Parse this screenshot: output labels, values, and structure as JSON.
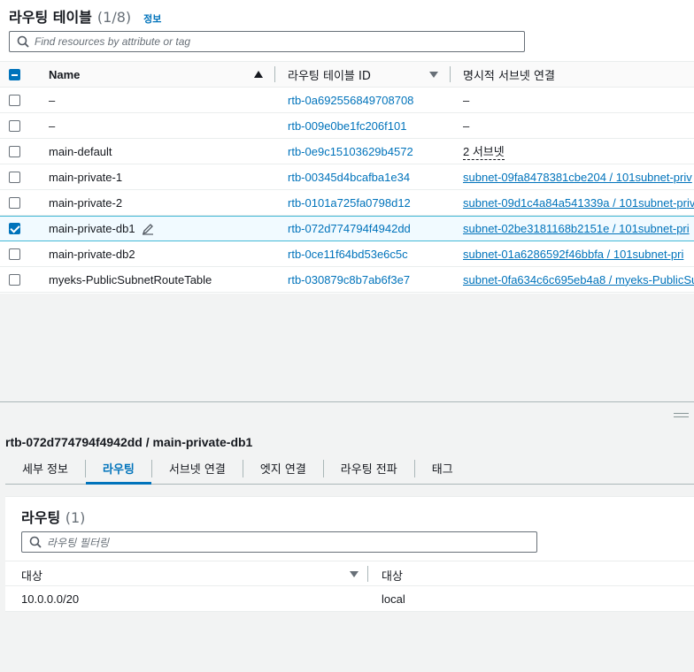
{
  "header": {
    "title": "라우팅 테이블",
    "count": "(1/8)",
    "info_link": "정보"
  },
  "search": {
    "placeholder": "Find resources by attribute or tag"
  },
  "table": {
    "columns": {
      "name": "Name",
      "id": "라우팅 테이블 ID",
      "subnet": "명시적 서브넷 연결"
    },
    "rows": [
      {
        "name": "–",
        "id": "rtb-0a692556849708708",
        "subnet": "–",
        "checked": false
      },
      {
        "name": "–",
        "id": "rtb-009e0be1fc206f101",
        "subnet": "–",
        "checked": false
      },
      {
        "name": "main-default",
        "id": "rtb-0e9c15103629b4572",
        "subnet": "2 서브넷",
        "checked": false
      },
      {
        "name": "main-private-1",
        "id": "rtb-00345d4bcafba1e34",
        "subnet": "subnet-09fa8478381cbe204 / 101subnet-priv",
        "checked": false
      },
      {
        "name": "main-private-2",
        "id": "rtb-0101a725fa0798d12",
        "subnet": "subnet-09d1c4a84a541339a / 101subnet-priv",
        "checked": false
      },
      {
        "name": "main-private-db1",
        "id": "rtb-072d774794f4942dd",
        "subnet": "subnet-02be3181168b2151e / 101subnet-pri",
        "checked": true
      },
      {
        "name": "main-private-db2",
        "id": "rtb-0ce11f64bd53e6c5c",
        "subnet": "subnet-01a6286592f46bbfa / 101subnet-pri",
        "checked": false
      },
      {
        "name": "myeks-PublicSubnetRouteTable",
        "id": "rtb-030879c8b7ab6f3e7",
        "subnet": "subnet-0fa634c6c695eb4a8 / myeks-PublicSu",
        "checked": false
      }
    ]
  },
  "detail": {
    "title": "rtb-072d774794f4942dd / main-private-db1",
    "tabs": [
      "세부 정보",
      "라우팅",
      "서브넷 연결",
      "엣지 연결",
      "라우팅 전파",
      "태그"
    ],
    "active_tab": "라우팅",
    "routes": {
      "title": "라우팅",
      "count": "(1)",
      "filter_placeholder": "라우팅 필터링",
      "columns": [
        "대상",
        "대상"
      ],
      "rows": [
        {
          "destination": "10.0.0.0/20",
          "target": "local"
        }
      ]
    }
  },
  "colors": {
    "link": "#0073bb",
    "selected_bg": "#f1faff",
    "selected_border": "#44b9d6"
  }
}
